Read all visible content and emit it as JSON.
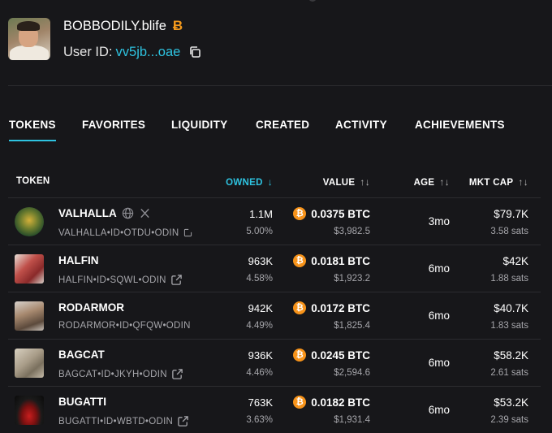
{
  "profile": {
    "username": "BOBBODILY.blife",
    "brand_mark": "Ƀ",
    "user_id_label": "User ID:",
    "user_id_value": "vv5jb...oae"
  },
  "tabs": [
    {
      "label": "TOKENS",
      "active": true
    },
    {
      "label": "FAVORITES",
      "active": false
    },
    {
      "label": "LIQUIDITY",
      "active": false
    },
    {
      "label": "CREATED",
      "active": false
    },
    {
      "label": "ACTIVITY",
      "active": false
    },
    {
      "label": "ACHIEVEMENTS",
      "active": false
    }
  ],
  "table": {
    "headers": {
      "token": "TOKEN",
      "owned": "OWNED",
      "owned_sort": "↓",
      "value": "VALUE",
      "age": "AGE",
      "mkt_cap": "MKT CAP",
      "sort_both": "↑↓"
    },
    "rows": [
      {
        "name": "VALHALLA",
        "id": "VALHALLA•ID•OTDU•ODIN",
        "owned": "1.1M",
        "owned_pct": "5.00%",
        "btc": "0.0375 BTC",
        "usd": "$3,982.5",
        "age": "3mo",
        "mkt_cap": "$79.7K",
        "sats": "3.58 sats",
        "socials": true
      },
      {
        "name": "HALFIN",
        "id": "HALFIN•ID•SQWL•ODIN",
        "owned": "963K",
        "owned_pct": "4.58%",
        "btc": "0.0181 BTC",
        "usd": "$1,923.2",
        "age": "6mo",
        "mkt_cap": "$42K",
        "sats": "1.88 sats",
        "socials": false
      },
      {
        "name": "RODARMOR",
        "id": "RODARMOR•ID•QFQW•ODIN",
        "owned": "942K",
        "owned_pct": "4.49%",
        "btc": "0.0172 BTC",
        "usd": "$1,825.4",
        "age": "6mo",
        "mkt_cap": "$40.7K",
        "sats": "1.83 sats",
        "socials": false
      },
      {
        "name": "BAGCAT",
        "id": "BAGCAT•ID•JKYH•ODIN",
        "owned": "936K",
        "owned_pct": "4.46%",
        "btc": "0.0245 BTC",
        "usd": "$2,594.6",
        "age": "6mo",
        "mkt_cap": "$58.2K",
        "sats": "2.61 sats",
        "socials": false
      },
      {
        "name": "BUGATTI",
        "id": "BUGATTI•ID•WBTD•ODIN",
        "owned": "763K",
        "owned_pct": "3.63%",
        "btc": "0.0182 BTC",
        "usd": "$1,931.4",
        "age": "6mo",
        "mkt_cap": "$53.2K",
        "sats": "2.39 sats",
        "socials": false
      }
    ]
  },
  "icons": {
    "btc_coin": "₿",
    "x_logo": "𝕏"
  },
  "colors": {
    "background": "#17171a",
    "accent": "#2ec3e0",
    "btc": "#f7931a",
    "muted": "#a6a6ab"
  }
}
